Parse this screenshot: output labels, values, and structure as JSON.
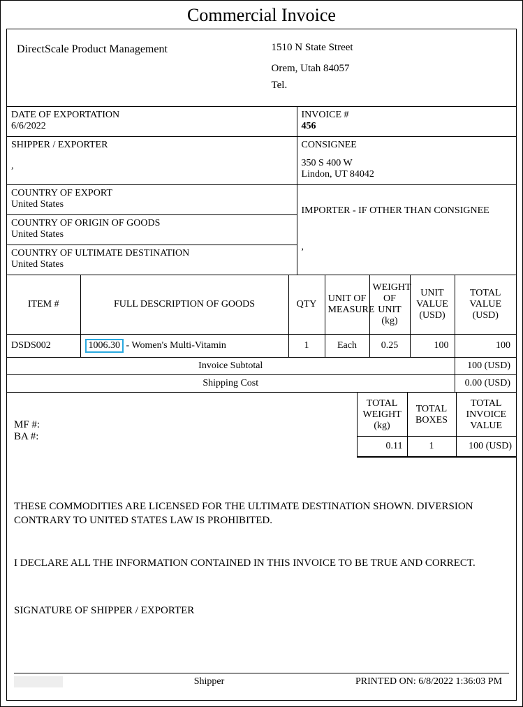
{
  "title": "Commercial Invoice",
  "from_name": "DirectScale Product Management",
  "to": {
    "line1": "1510 N State Street",
    "line2": "Orem, Utah 84057",
    "tel": "Tel."
  },
  "date_label": "DATE OF EXPORTATION",
  "date_value": "6/6/2022",
  "invoice_num_label": "INVOICE #",
  "invoice_num_value": "456",
  "shipper_label": "SHIPPER / EXPORTER",
  "shipper_value": ",",
  "consignee_label": "CONSIGNEE",
  "consignee_line1": "350 S 400 W",
  "consignee_line2": "Lindon, UT 84042",
  "country_export_label": "COUNTRY OF EXPORT",
  "country_export_value": "United States",
  "country_origin_label": "COUNTRY OF ORIGIN OF GOODS",
  "country_origin_value": "United States",
  "country_dest_label": "COUNTRY OF ULTIMATE DESTINATION",
  "country_dest_value": "United States",
  "importer_label": "IMPORTER - IF OTHER THAN CONSIGNEE",
  "importer_value": ",",
  "headers": {
    "item": "ITEM #",
    "desc": "FULL DESCRIPTION OF GOODS",
    "qty": "QTY",
    "uom": "UNIT OF MEASURE",
    "wou": "WEIGHT OF UNIT (kg)",
    "uv": "UNIT VALUE (USD)",
    "tv": "TOTAL VALUE (USD)"
  },
  "item": {
    "sku": "DSDS002",
    "code": "1006.30",
    "desc_suffix": " - Women's Multi-Vitamin",
    "qty": "1",
    "uom": "Each",
    "weight": "0.25",
    "unit_value": "100",
    "total_value": "100"
  },
  "subtotal_label": "Invoice Subtotal",
  "subtotal_value": "100 (USD)",
  "shipping_label": "Shipping Cost",
  "shipping_value": "0.00 (USD)",
  "mf_label": "MF #:",
  "ba_label": "BA #:",
  "totals": {
    "weight_label": "TOTAL WEIGHT (kg)",
    "boxes_label": "TOTAL BOXES",
    "invoice_label": "TOTAL INVOICE VALUE",
    "weight_value": "0.11",
    "boxes_value": "1",
    "invoice_value": "100 (USD)"
  },
  "decl1": "THESE COMMODITIES ARE LICENSED FOR THE ULTIMATE DESTINATION SHOWN. DIVERSION CONTRARY TO UNITED STATES LAW IS PROHIBITED.",
  "decl2": "I DECLARE ALL THE INFORMATION CONTAINED IN THIS INVOICE TO BE TRUE AND CORRECT.",
  "sig_label": "SIGNATURE OF SHIPPER / EXPORTER",
  "footer_shipper": "Shipper",
  "printed_label": "PRINTED ON: 6/8/2022 1:36:03 PM"
}
